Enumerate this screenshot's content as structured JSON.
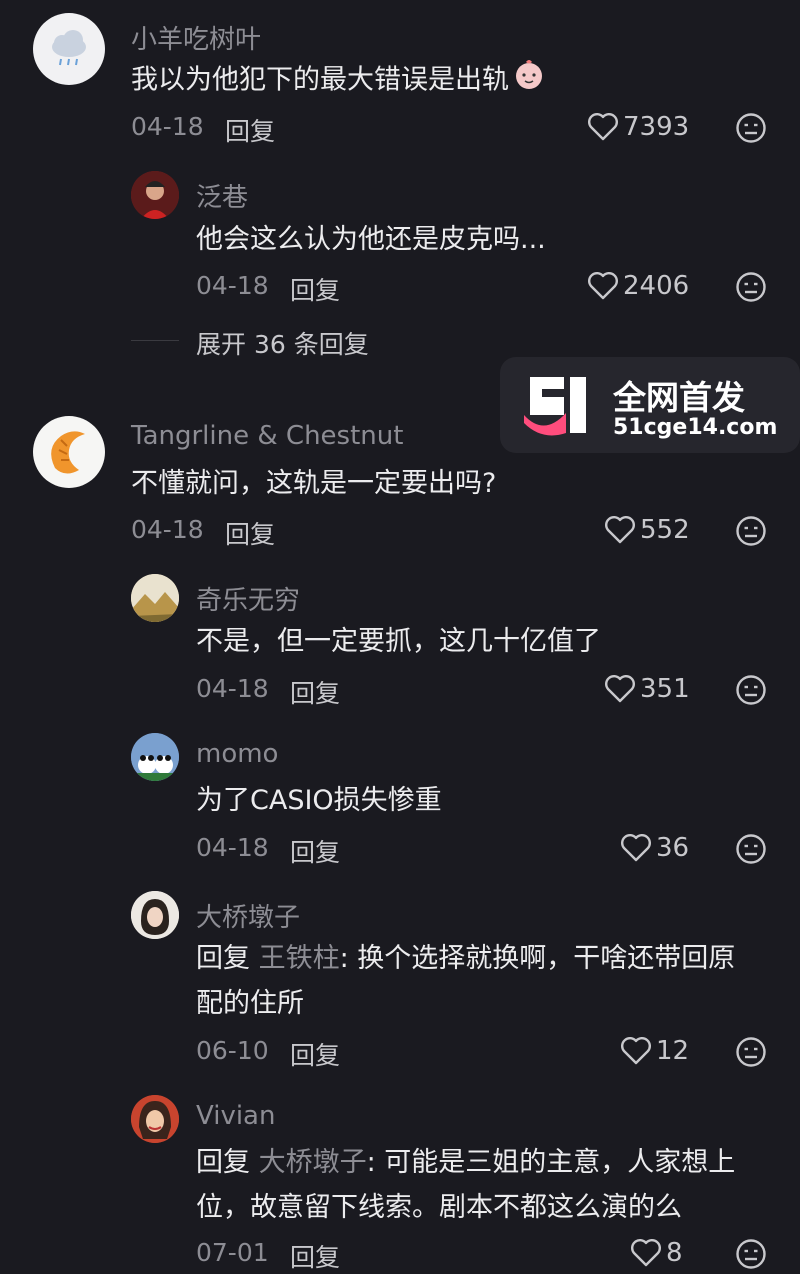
{
  "comments": [
    {
      "name": "小羊吃树叶",
      "text": "我以为他犯下的最大错误是出轨",
      "date": "04-18",
      "reply_label": "回复",
      "likes": "7393"
    },
    {
      "name": "泛巷",
      "text": "他会这么认为他还是皮克吗...",
      "date": "04-18",
      "reply_label": "回复",
      "likes": "2406"
    },
    {
      "name": "Tangrline & Chestnut",
      "text": "不懂就问，这轨是一定要出吗?",
      "date": "04-18",
      "reply_label": "回复",
      "likes": "552"
    },
    {
      "name": "奇乐无穷",
      "text": "不是，但一定要抓，这几十亿值了",
      "date": "04-18",
      "reply_label": "回复",
      "likes": "351"
    },
    {
      "name": "momo",
      "text": "为了CASIO损失惨重",
      "date": "04-18",
      "reply_label": "回复",
      "likes": "36"
    },
    {
      "name": "大桥墩子",
      "reply_prefix": "回复",
      "reply_to": "王铁柱",
      "text_line1": ": 换个选择就换啊，干啥还带回原",
      "text_line2": "配的住所",
      "date": "06-10",
      "reply_label": "回复",
      "likes": "12"
    },
    {
      "name": "Vivian",
      "reply_prefix": "回复",
      "reply_to": "大桥墩子",
      "text_line1": ": 可能是三姐的主意，人家想上",
      "text_line2": "位，故意留下线索。剧本不都这么演的么",
      "date": "07-01",
      "reply_label": "回复",
      "likes": "8"
    }
  ],
  "expand": {
    "label": "展开 36 条回复"
  },
  "watermark": {
    "title": "全网首发",
    "url": "51cge14.com"
  },
  "colors": {
    "background": "#1a1a20",
    "secondary_text": "#8d8d94",
    "primary_text": "#ececee"
  }
}
